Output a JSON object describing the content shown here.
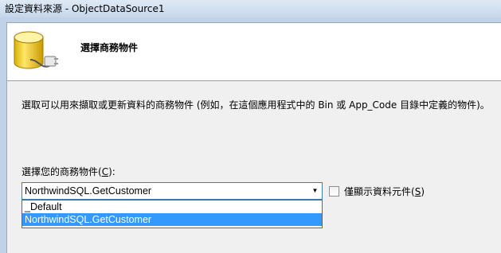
{
  "window": {
    "title": "設定資料來源 - ObjectDataSource1"
  },
  "header": {
    "step_title": "選擇商務物件",
    "icon": "database-plug-icon"
  },
  "body": {
    "description": "選取可以用來擷取或更新資料的商務物件 (例如，在這個應用程式中的 Bin 或 App_Code 目錄中定義的物件)。",
    "combo_label_pre": "選擇您的商務物件(",
    "combo_label_key": "C",
    "combo_label_post": "):",
    "combo_value": "NorthwindSQL.GetCustomer",
    "dropdown_options": [
      "_Default",
      "NorthwindSQL.GetCustomer"
    ],
    "selected_index": 1,
    "checkbox_label_pre": "僅顯示資料元件(",
    "checkbox_label_key": "S",
    "checkbox_label_post": ")",
    "checkbox_checked": false
  }
}
